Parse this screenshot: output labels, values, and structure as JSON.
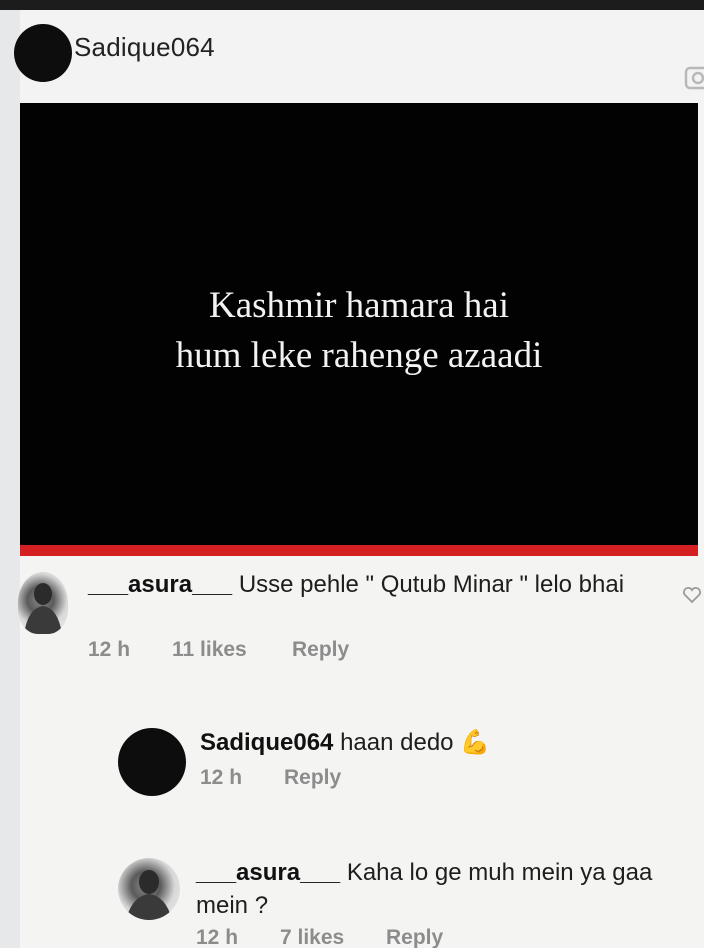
{
  "post": {
    "username": "Sadique064",
    "image_text_line1": "Kashmir hamara hai",
    "image_text_line2": "hum leke rahenge azaadi",
    "video_progress": 1.0
  },
  "comments": [
    {
      "username": "___asura___",
      "text": "Usse pehle \" Qutub Minar  \" lelo bhai",
      "time": "12 h",
      "likes": "11 likes",
      "reply_label": "Reply"
    },
    {
      "username": "Sadique064",
      "text": "haan dedo",
      "emoji": "💪",
      "time": "12 h",
      "reply_label": "Reply"
    },
    {
      "username": "___asura___",
      "text": "Kaha lo ge muh mein ya gaa mein ?",
      "time": "12 h",
      "likes": "7 likes",
      "reply_label": "Reply"
    }
  ],
  "icons": {
    "heart": "heart-outline-icon",
    "camera": "camera-icon"
  },
  "colors": {
    "progress": "#d42020",
    "meta_text": "#8c8c8c"
  }
}
